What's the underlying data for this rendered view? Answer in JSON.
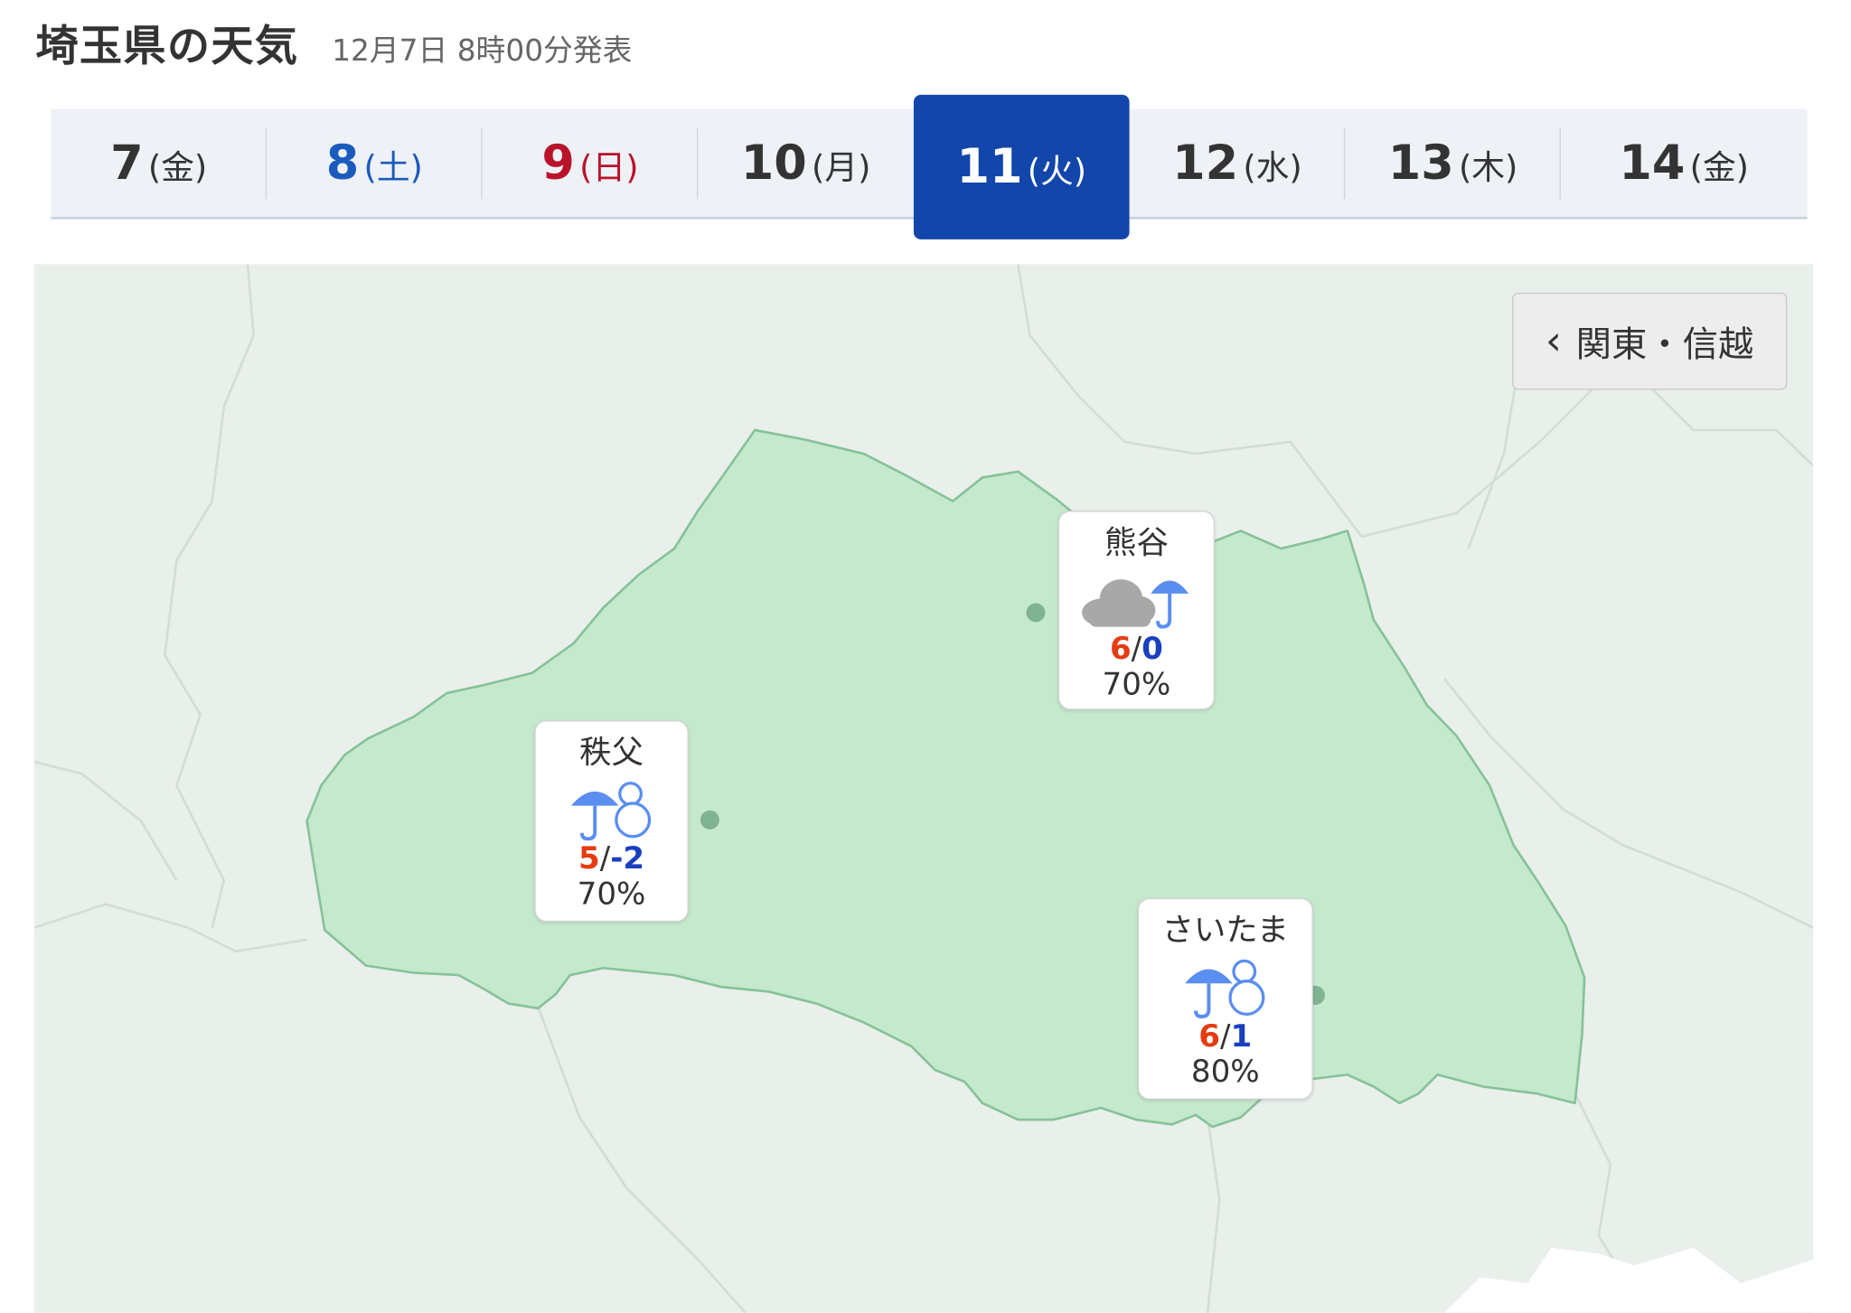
{
  "header": {
    "title": "埼玉県の天気",
    "announce": "12月7日 8時00分発表"
  },
  "dates": [
    {
      "day": "7",
      "dow": "(金)",
      "kind": "weekday"
    },
    {
      "day": "8",
      "dow": "(土)",
      "kind": "sat"
    },
    {
      "day": "9",
      "dow": "(日)",
      "kind": "sun"
    },
    {
      "day": "10",
      "dow": "(月)",
      "kind": "weekday"
    },
    {
      "day": "11",
      "dow": "(火)",
      "kind": "active"
    },
    {
      "day": "12",
      "dow": "(水)",
      "kind": "weekday"
    },
    {
      "day": "13",
      "dow": "(木)",
      "kind": "weekday"
    },
    {
      "day": "14",
      "dow": "(金)",
      "kind": "weekday"
    }
  ],
  "region_button": {
    "label": "関東・信越",
    "icon": "chevron-left-icon"
  },
  "cities": [
    {
      "name": "熊谷",
      "weather": "cloudy-then-rain",
      "high": "6",
      "low": "0",
      "pop": "70%"
    },
    {
      "name": "秩父",
      "weather": "rain-or-snow",
      "high": "5",
      "low": "-2",
      "pop": "70%"
    },
    {
      "name": "さいたま",
      "weather": "rain-or-snow",
      "high": "6",
      "low": "1",
      "pop": "80%"
    }
  ],
  "colors": {
    "active_tab": "#1346ab",
    "saturday": "#1a5bbb",
    "sunday": "#b9132a",
    "high_temp": "#e63b12",
    "low_temp": "#1a3fbf",
    "prefecture_fill": "#c5e9cd",
    "map_background": "#e9efea"
  }
}
